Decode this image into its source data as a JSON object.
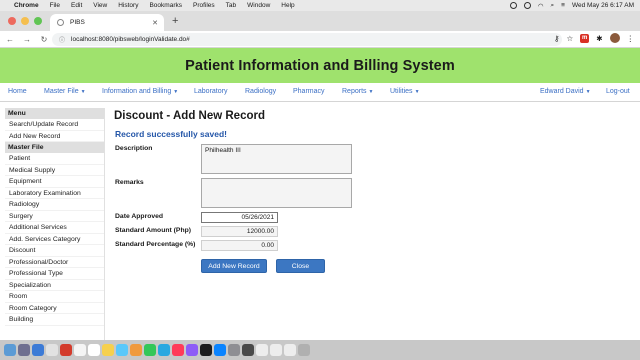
{
  "menubar": {
    "app_name": "Chrome",
    "items": [
      "File",
      "Edit",
      "View",
      "History",
      "Bookmarks",
      "Profiles",
      "Tab",
      "Window",
      "Help"
    ],
    "datetime": "Wed May 26  6:17 AM"
  },
  "browser": {
    "tab_title": "PIBS",
    "url": "localhost:8080/pibsweb/loginValidate.do#",
    "ext_label": "m",
    "accent_color": "#d93025"
  },
  "app": {
    "title": "Patient Information and Billing System",
    "header_color": "#9fe26d",
    "link_color": "#3b6fc4",
    "nav": {
      "home": "Home",
      "master_file": "Master File",
      "info_billing": "Information and Billing",
      "laboratory": "Laboratory",
      "radiology": "Radiology",
      "pharmacy": "Pharmacy",
      "reports": "Reports",
      "utilities": "Utilities",
      "user": "Edward David",
      "logout": "Log-out"
    }
  },
  "sidebar": {
    "menu_header": "Menu",
    "top_items": [
      "Search/Update Record",
      "Add New Record"
    ],
    "section_header": "Master File",
    "items": [
      "Patient",
      "Medical Supply",
      "Equipment",
      "Laboratory Examination",
      "Radiology",
      "Surgery",
      "Additional Services",
      "Add. Services Category",
      "Discount",
      "Professional/Doctor",
      "Professional Type",
      "Specialization",
      "Room",
      "Room Category",
      "Building"
    ]
  },
  "form": {
    "page_title": "Discount - Add New Record",
    "success_message": "Record successfully saved!",
    "success_color": "#2456a8",
    "description_label": "Description",
    "description_value": "Philhealth III",
    "remarks_label": "Remarks",
    "remarks_value": "",
    "date_label": "Date Approved",
    "date_value": "05/26/2021",
    "amount_label": "Standard Amount (Php)",
    "amount_value": "12000.00",
    "percentage_label": "Standard Percentage (%)",
    "percentage_value": "0.00",
    "add_button": "Add New Record",
    "close_button": "Close",
    "button_color": "#3c77c2"
  }
}
